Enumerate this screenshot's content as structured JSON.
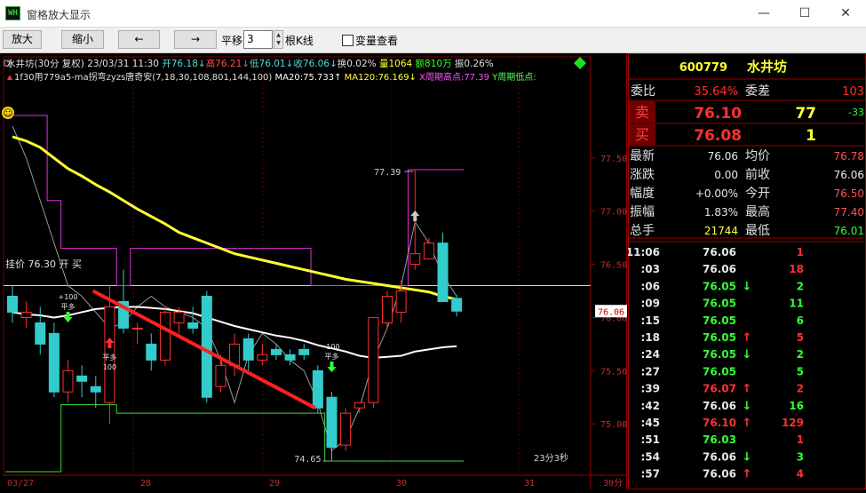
{
  "window": {
    "title": "窗格放大显示",
    "icon_text": "WH",
    "minimize": "—",
    "maximize": "☐",
    "close": "✕"
  },
  "toolbar": {
    "zoom_in": "放大",
    "zoom_out": "缩小",
    "left_arrow": "←",
    "right_arrow": "→",
    "shift_label": "平移",
    "shift_value": "3",
    "shift_unit": "根K线",
    "var_check_label": "变量查看",
    "var_checked": false
  },
  "chart_header": {
    "line1": [
      {
        "t": "水井坊(30分 复权) 23/03/31 11:30 ",
        "c": "#e0e0e0"
      },
      {
        "t": "开76.18↓",
        "c": "#55d8d8"
      },
      {
        "t": "高76.21↓",
        "c": "#ff5050"
      },
      {
        "t": "低76.01↓",
        "c": "#55d8d8"
      },
      {
        "t": "收76.06↓",
        "c": "#55d8d8"
      },
      {
        "t": "换0.02% ",
        "c": "#e0e0e0"
      },
      {
        "t": "量1064 ",
        "c": "#ffff33"
      },
      {
        "t": "额810万 ",
        "c": "#33ff33"
      },
      {
        "t": "振0.26%",
        "c": "#e0e0e0"
      }
    ],
    "line2": [
      {
        "t": "1f30用779a5-ma拐弯zyzs唐奇安(7,18,30,108,801,144,100) ",
        "c": "#e0e0e0"
      },
      {
        "t": "MA20:75.733↑ ",
        "c": "#ffffff"
      },
      {
        "t": "MA120:76.169↓ ",
        "c": "#ffff33"
      },
      {
        "t": "X周期高点:77.39 ",
        "c": "#ff55ff"
      },
      {
        "t": "Y周期低点:",
        "c": "#55ff55"
      }
    ]
  },
  "hang_price": "挂价 76.30 开 买",
  "price_axis": [
    "77.50",
    "77.00",
    "76.50",
    "76.00",
    "75.50",
    "75.00"
  ],
  "current_price_tag": "76.06",
  "time_axis": [
    "03/27",
    "28",
    "29",
    "30",
    "31",
    "30分"
  ],
  "annotations": {
    "high_label": "77.39",
    "low_label": "74.65",
    "countdown": "23分3秒",
    "signal1_top": "+100",
    "signal1_bottom": "平多",
    "signal2_top": "平多",
    "signal2_bottom": "100",
    "signal3_top": "-100",
    "signal3_bottom": "平多",
    "smiley": "☺"
  },
  "chart_data": {
    "type": "candlestick",
    "ylim": [
      74.5,
      77.9
    ],
    "hline": 76.3,
    "candles": [
      [
        76.2,
        76.05,
        76.3,
        75.95
      ],
      [
        76.0,
        76.05,
        76.15,
        75.9
      ],
      [
        75.95,
        75.75,
        76.1,
        75.65
      ],
      [
        75.85,
        75.3,
        75.95,
        75.25
      ],
      [
        75.3,
        75.5,
        75.6,
        75.2
      ],
      [
        75.45,
        75.4,
        75.55,
        75.25
      ],
      [
        75.35,
        75.3,
        75.45,
        75.15
      ],
      [
        75.2,
        76.1,
        76.3,
        75.0
      ],
      [
        76.15,
        75.9,
        76.45,
        75.85
      ],
      [
        75.9,
        75.9,
        75.95,
        75.75
      ],
      [
        75.75,
        75.6,
        75.85,
        75.5
      ],
      [
        75.6,
        76.05,
        76.1,
        75.55
      ],
      [
        75.95,
        76.05,
        76.1,
        75.85
      ],
      [
        75.95,
        75.9,
        76.1,
        75.85
      ],
      [
        76.2,
        75.25,
        76.25,
        75.2
      ],
      [
        75.35,
        75.55,
        75.65,
        75.3
      ],
      [
        75.55,
        75.75,
        75.85,
        75.45
      ],
      [
        75.8,
        75.6,
        75.85,
        75.5
      ],
      [
        75.6,
        75.65,
        75.75,
        75.55
      ],
      [
        75.7,
        75.65,
        75.75,
        75.6
      ],
      [
        75.65,
        75.6,
        75.7,
        75.55
      ],
      [
        75.7,
        75.65,
        75.75,
        75.6
      ],
      [
        75.5,
        75.15,
        75.55,
        75.1
      ],
      [
        75.25,
        74.78,
        75.3,
        74.65
      ],
      [
        74.8,
        75.1,
        75.15,
        74.75
      ],
      [
        75.15,
        75.2,
        75.2,
        75.1
      ],
      [
        75.2,
        76.0,
        76.0,
        75.15
      ],
      [
        75.95,
        76.2,
        76.25,
        75.9
      ],
      [
        76.05,
        76.25,
        76.35,
        75.95
      ],
      [
        76.5,
        76.6,
        77.39,
        76.45
      ],
      [
        76.55,
        76.7,
        76.75,
        76.55
      ],
      [
        76.7,
        76.15,
        76.8,
        76.15
      ],
      [
        76.18,
        76.06,
        76.21,
        76.01
      ]
    ],
    "ma120": [
      77.7,
      77.66,
      77.6,
      77.5,
      77.4,
      77.33,
      77.25,
      77.18,
      77.1,
      77.02,
      76.95,
      76.88,
      76.8,
      76.75,
      76.7,
      76.65,
      76.6,
      76.57,
      76.54,
      76.51,
      76.48,
      76.45,
      76.42,
      76.39,
      76.36,
      76.34,
      76.32,
      76.3,
      76.28,
      76.26,
      76.24,
      76.2,
      76.17
    ],
    "ma20": [
      76.05,
      76.03,
      76.02,
      76.0,
      76.02,
      76.05,
      76.08,
      76.09,
      76.1,
      76.1,
      76.09,
      76.08,
      76.06,
      76.04,
      76.0,
      75.96,
      75.92,
      75.89,
      75.86,
      75.83,
      75.81,
      75.78,
      75.74,
      75.71,
      75.68,
      75.64,
      75.62,
      75.63,
      75.64,
      75.68,
      75.7,
      75.72,
      75.73
    ],
    "period_high": [
      77.9,
      77.9,
      77.9,
      77.1,
      76.65,
      76.65,
      76.65,
      76.65,
      76.3,
      76.65,
      76.65,
      76.65,
      76.65,
      76.65,
      76.65,
      76.65,
      76.65,
      76.65,
      76.65,
      76.65,
      76.65,
      76.65,
      76.3,
      76.3,
      76.3,
      76.3,
      76.3,
      76.3,
      76.3,
      77.39,
      77.39,
      77.39,
      77.39
    ],
    "period_low": [
      74.55,
      74.55,
      74.55,
      74.55,
      75.18,
      75.18,
      75.18,
      75.18,
      75.1,
      75.1,
      75.1,
      75.1,
      75.1,
      75.1,
      75.1,
      75.1,
      75.1,
      75.1,
      75.1,
      75.1,
      75.1,
      75.1,
      75.1,
      74.65,
      74.65,
      74.65,
      74.65,
      74.65,
      74.65,
      74.65,
      74.65,
      74.65,
      74.65
    ],
    "gray_line": [
      77.8,
      77.5,
      77.1,
      76.7,
      76.3,
      76.2,
      76.05,
      75.9,
      75.95,
      76.1,
      76.2,
      76.1,
      76.05,
      76.0,
      75.9,
      75.6,
      75.2,
      75.65,
      75.85,
      75.75,
      75.6,
      75.5,
      75.2,
      74.75,
      74.85,
      75.15,
      75.6,
      75.9,
      76.3,
      76.9,
      76.7,
      76.4,
      76.2
    ],
    "trendline": [
      [
        5.8,
        76.25
      ],
      [
        21.8,
        75.15
      ]
    ]
  },
  "quote": {
    "code": "600779",
    "name": "水井坊",
    "weibi_label": "委比",
    "weibi": "35.64%",
    "weicha_label": "委差",
    "weicha": "103",
    "sell_label": "卖",
    "sell_price": "76.10",
    "sell_vol": "77",
    "sell_change": "-33",
    "buy_label": "买",
    "buy_price": "76.08",
    "buy_vol": "1",
    "stats": [
      {
        "l1": "最新",
        "v1": "76.06",
        "c1": "#e8e8e8",
        "l2": "均价",
        "v2": "76.78",
        "c2": "#ff5050"
      },
      {
        "l1": "涨跌",
        "v1": "0.00",
        "c1": "#e8e8e8",
        "l2": "前收",
        "v2": "76.06",
        "c2": "#e8e8e8"
      },
      {
        "l1": "幅度",
        "v1": "+0.00%",
        "c1": "#e8e8e8",
        "l2": "今开",
        "v2": "76.50",
        "c2": "#ff5050"
      },
      {
        "l1": "振幅",
        "v1": "1.83%",
        "c1": "#e8e8e8",
        "l2": "最高",
        "v2": "77.40",
        "c2": "#ff5050"
      },
      {
        "l1": "总手",
        "v1": "21744",
        "c1": "#ffff33",
        "l2": "最低",
        "v2": "76.01",
        "c2": "#33ff33"
      }
    ]
  },
  "ticks": [
    {
      "time": "11:06",
      "price": "76.06",
      "pc": "#e8e8e8",
      "arrow": "",
      "ac": "",
      "vol": "1",
      "vc": "#ff3030"
    },
    {
      "time": ":03",
      "price": "76.06",
      "pc": "#e8e8e8",
      "arrow": "",
      "ac": "",
      "vol": "18",
      "vc": "#ff3030"
    },
    {
      "time": ":06",
      "price": "76.05",
      "pc": "#33ff33",
      "arrow": "↓",
      "ac": "#33ff33",
      "vol": "2",
      "vc": "#33ff33"
    },
    {
      "time": ":09",
      "price": "76.05",
      "pc": "#33ff33",
      "arrow": "",
      "ac": "",
      "vol": "11",
      "vc": "#33ff33"
    },
    {
      "time": ":15",
      "price": "76.05",
      "pc": "#33ff33",
      "arrow": "",
      "ac": "",
      "vol": "6",
      "vc": "#33ff33"
    },
    {
      "time": ":18",
      "price": "76.05",
      "pc": "#33ff33",
      "arrow": "↑",
      "ac": "#ff3030",
      "vol": "5",
      "vc": "#ff3030"
    },
    {
      "time": ":24",
      "price": "76.05",
      "pc": "#33ff33",
      "arrow": "↓",
      "ac": "#33ff33",
      "vol": "2",
      "vc": "#33ff33"
    },
    {
      "time": ":27",
      "price": "76.05",
      "pc": "#33ff33",
      "arrow": "",
      "ac": "",
      "vol": "5",
      "vc": "#33ff33"
    },
    {
      "time": ":39",
      "price": "76.07",
      "pc": "#ff3030",
      "arrow": "↑",
      "ac": "#ff3030",
      "vol": "2",
      "vc": "#ff3030"
    },
    {
      "time": ":42",
      "price": "76.06",
      "pc": "#e8e8e8",
      "arrow": "↓",
      "ac": "#33ff33",
      "vol": "16",
      "vc": "#33ff33"
    },
    {
      "time": ":45",
      "price": "76.10",
      "pc": "#ff3030",
      "arrow": "↑",
      "ac": "#ff3030",
      "vol": "129",
      "vc": "#ff3030"
    },
    {
      "time": ":51",
      "price": "76.03",
      "pc": "#33ff33",
      "arrow": "",
      "ac": "",
      "vol": "1",
      "vc": "#ff3030"
    },
    {
      "time": ":54",
      "price": "76.06",
      "pc": "#e8e8e8",
      "arrow": "↓",
      "ac": "#33ff33",
      "vol": "3",
      "vc": "#33ff33"
    },
    {
      "time": ":57",
      "price": "76.06",
      "pc": "#e8e8e8",
      "arrow": "↑",
      "ac": "#ff3030",
      "vol": "4",
      "vc": "#ff3030"
    }
  ]
}
